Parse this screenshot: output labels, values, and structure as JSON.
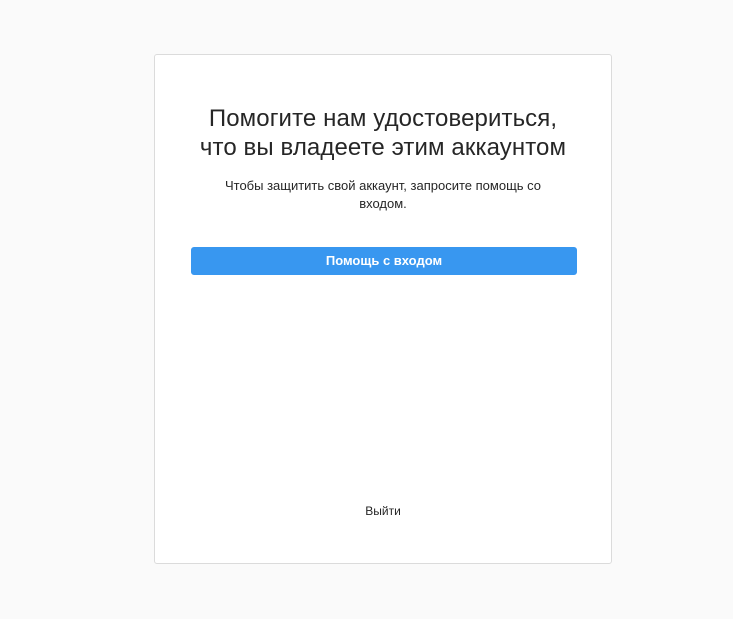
{
  "card": {
    "title_line1": "Помогите нам удостовериться,",
    "title_line2": "что вы владеете этим аккаунтом",
    "subtitle": "Чтобы защитить свой аккаунт, запросите помощь со входом.",
    "help_button_label": "Помощь с входом",
    "logout_label": "Выйти"
  },
  "colors": {
    "accent": "#3897f0",
    "background": "#fafafa",
    "card": "#ffffff",
    "border": "#dbdbdb",
    "text": "#262626"
  }
}
